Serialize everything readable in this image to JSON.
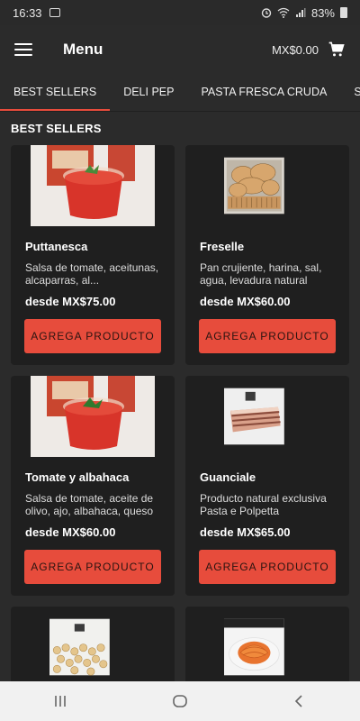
{
  "status": {
    "time": "16:33",
    "battery": "83%"
  },
  "appbar": {
    "title": "Menu",
    "cart_total": "MX$0.00"
  },
  "tabs": [
    {
      "label": "BEST SELLERS"
    },
    {
      "label": "DELI PEP"
    },
    {
      "label": "PASTA FRESCA CRUDA"
    },
    {
      "label": "SALS"
    }
  ],
  "section_title": "BEST SELLERS",
  "products": [
    {
      "name": "Puttanesca",
      "desc": "Salsa de tomate, aceitunas, alcaparras, al...",
      "price": "desde MX$75.00",
      "button": "AGREGA PRODUCTO"
    },
    {
      "name": "Freselle",
      "desc": "Pan crujiente, harina, sal, agua, levadura natural",
      "price": "desde MX$60.00",
      "button": "AGREGA PRODUCTO"
    },
    {
      "name": "Tomate y albahaca",
      "desc": "Salsa de tomate, aceite de olivo, ajo, albahaca, queso",
      "price": "desde MX$60.00",
      "button": "AGREGA PRODUCTO"
    },
    {
      "name": "Guanciale",
      "desc": "Producto natural exclusiva Pasta e Polpetta",
      "price": "desde MX$65.00",
      "button": "AGREGA PRODUCTO"
    }
  ]
}
